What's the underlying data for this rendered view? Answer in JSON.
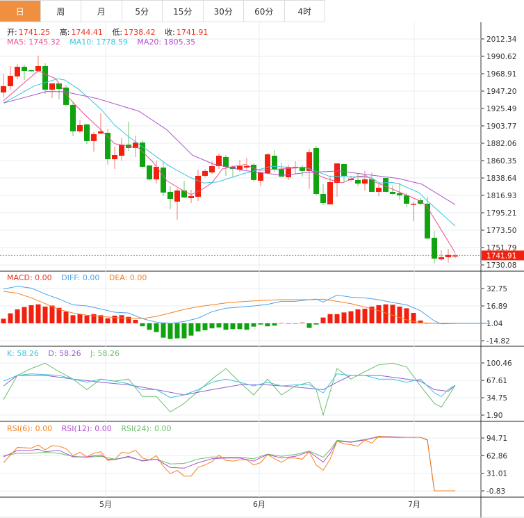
{
  "tabs": [
    {
      "label": "日",
      "active": true
    },
    {
      "label": "周"
    },
    {
      "label": "月"
    },
    {
      "label": "5分"
    },
    {
      "label": "15分"
    },
    {
      "label": "30分"
    },
    {
      "label": "60分"
    },
    {
      "label": "4时"
    }
  ],
  "ohlc": {
    "open_label": "开:",
    "open": "1741.25",
    "high_label": "高:",
    "high": "1744.41",
    "low_label": "低:",
    "low": "1738.42",
    "close_label": "收:",
    "close": "1741.91"
  },
  "ma_legend": {
    "ma5": "MA5: 1745.32",
    "ma10": "MA10: 1778.59",
    "ma20": "MA20: 1805.35"
  },
  "macd_legend": {
    "macd": "MACD: 0.00",
    "diff": "DIFF: 0.00",
    "dea": "DEA: 0.00"
  },
  "kdj_legend": {
    "k": "K: 58.26",
    "d": "D: 58.26",
    "j": "J: 58.26"
  },
  "rsi_legend": {
    "rsi6": "RSI(6): 0.00",
    "rsi12": "RSI(12): 0.00",
    "rsi24": "RSI(24): 0.00"
  },
  "colors": {
    "up": "#f2200e",
    "down": "#10a310",
    "ma5": "#ee4f8f",
    "ma10": "#39c5dd",
    "ma20": "#b04fce",
    "active_tab": "#f18f41",
    "diff": "#4ca3ea",
    "dea": "#f5801e",
    "k": "#39c5dd",
    "d": "#8e5fd0",
    "j": "#6cbe6c",
    "rsi6": "#f5801e",
    "rsi12": "#b04fce",
    "rsi24": "#6cbe6c"
  },
  "chart_data": {
    "type": "candlestick",
    "x_labels": [
      {
        "label": "5月",
        "index": 14.7
      },
      {
        "label": "6月",
        "index": 36.8
      },
      {
        "label": "7月",
        "index": 59.1
      }
    ],
    "current_price": "1741.91",
    "price_ticks": [
      "2012.34",
      "1990.62",
      "1968.91",
      "1947.20",
      "1925.49",
      "1903.77",
      "1882.06",
      "1860.35",
      "1838.64",
      "1816.93",
      "1795.21",
      "1773.50",
      "1751.79",
      "1730.08"
    ],
    "candles_ohlc_note": "[open, close, high, low]",
    "candles": [
      [
        1945.5,
        1953.3,
        1968.9,
        1939.4
      ],
      [
        1953.3,
        1966.3,
        1978.5,
        1949.0
      ],
      [
        1965.5,
        1977.6,
        1981.1,
        1962.0
      ],
      [
        1977.6,
        1972.4,
        1980.2,
        1961.1
      ],
      [
        1973.3,
        1972.4,
        1974.2,
        1971.5
      ],
      [
        1972.4,
        1978.5,
        1991.5,
        1970.7
      ],
      [
        1978.5,
        1949.0,
        1982.0,
        1943.8
      ],
      [
        1949.0,
        1956.8,
        1956.8,
        1938.5
      ],
      [
        1956.8,
        1949.8,
        1956.8,
        1936.8
      ],
      [
        1951.6,
        1929.9,
        1955.0,
        1928.1
      ],
      [
        1929.9,
        1896.9,
        1934.2,
        1890.8
      ],
      [
        1896.9,
        1904.7,
        1910.7,
        1895.1
      ],
      [
        1905.5,
        1884.7,
        1906.4,
        1881.2
      ],
      [
        1884.7,
        1893.4,
        1896.0,
        1871.7
      ],
      [
        1894.2,
        1896.9,
        1919.4,
        1893.4
      ],
      [
        1895.1,
        1862.1,
        1899.5,
        1855.2
      ],
      [
        1862.1,
        1867.3,
        1877.7,
        1849.9
      ],
      [
        1866.5,
        1880.4,
        1889.0,
        1860.4
      ],
      [
        1880.4,
        1876.0,
        1909.0,
        1872.5
      ],
      [
        1876.0,
        1883.0,
        1891.6,
        1864.7
      ],
      [
        1883.0,
        1852.6,
        1885.6,
        1851.7
      ],
      [
        1854.3,
        1836.9,
        1855.2,
        1835.2
      ],
      [
        1836.9,
        1852.6,
        1860.4,
        1831.7
      ],
      [
        1851.7,
        1820.4,
        1858.6,
        1816.1
      ],
      [
        1821.3,
        1812.6,
        1828.2,
        1799.6
      ],
      [
        1809.1,
        1823.0,
        1825.6,
        1786.5
      ],
      [
        1823.0,
        1814.3,
        1835.2,
        1813.5
      ],
      [
        1813.5,
        1816.1,
        1823.9,
        1807.4
      ],
      [
        1815.2,
        1841.3,
        1849.1,
        1810.0
      ],
      [
        1841.3,
        1847.4,
        1849.9,
        1839.5
      ],
      [
        1845.6,
        1853.4,
        1859.5,
        1843.9
      ],
      [
        1853.4,
        1866.5,
        1869.1,
        1849.9
      ],
      [
        1864.7,
        1852.6,
        1867.3,
        1841.3
      ],
      [
        1852.6,
        1849.9,
        1854.3,
        1840.4
      ],
      [
        1849.1,
        1853.4,
        1861.2,
        1846.5
      ],
      [
        1851.7,
        1853.4,
        1863.9,
        1849.1
      ],
      [
        1855.2,
        1836.1,
        1856.9,
        1834.3
      ],
      [
        1835.2,
        1845.6,
        1846.5,
        1828.2
      ],
      [
        1844.7,
        1868.2,
        1869.9,
        1843.9
      ],
      [
        1866.5,
        1849.9,
        1873.4,
        1846.5
      ],
      [
        1849.9,
        1840.4,
        1857.8,
        1840.4
      ],
      [
        1839.5,
        1851.7,
        1855.2,
        1836.1
      ],
      [
        1850.8,
        1852.6,
        1859.5,
        1843.9
      ],
      [
        1852.6,
        1847.4,
        1855.2,
        1840.4
      ],
      [
        1847.4,
        1870.8,
        1875.1,
        1824.8
      ],
      [
        1876.0,
        1818.7,
        1878.6,
        1816.9
      ],
      [
        1818.7,
        1807.4,
        1830.9,
        1804.8
      ],
      [
        1805.7,
        1833.5,
        1841.3,
        1805.7
      ],
      [
        1832.6,
        1856.9,
        1856.9,
        1815.2
      ],
      [
        1856.0,
        1841.3,
        1856.9,
        1834.3
      ],
      [
        1836.1,
        1837.8,
        1841.3,
        1834.3
      ],
      [
        1836.1,
        1831.7,
        1843.9,
        1828.2
      ],
      [
        1831.7,
        1836.9,
        1847.4,
        1823.0
      ],
      [
        1836.9,
        1821.3,
        1845.6,
        1821.3
      ],
      [
        1821.3,
        1826.5,
        1831.7,
        1816.1
      ],
      [
        1838.7,
        1821.3,
        1838.7,
        1820.4
      ],
      [
        1821.3,
        1818.7,
        1829.1,
        1817.8
      ],
      [
        1819.6,
        1816.9,
        1832.6,
        1811.7
      ],
      [
        1816.9,
        1806.5,
        1819.6,
        1802.2
      ],
      [
        1805.7,
        1806.5,
        1809.1,
        1784.8
      ],
      [
        1810.9,
        1806.5,
        1813.5,
        1804.8
      ],
      [
        1806.5,
        1763.1,
        1815.2,
        1763.1
      ],
      [
        1764.0,
        1738.0,
        1772.7,
        1731.8
      ],
      [
        1737.1,
        1739.7,
        1748.3,
        1735.3
      ],
      [
        1739.7,
        1742.5,
        1750.0,
        1733.0
      ],
      [
        1741.25,
        1741.91,
        1744.41,
        1738.42
      ]
    ],
    "ma5": {
      "x": [
        0,
        5,
        6,
        7.5,
        9.5,
        11.5,
        14,
        16,
        19.5,
        21.5,
        23.5,
        26,
        27,
        28.5,
        30,
        31.5,
        32.8,
        34.8,
        36.8,
        39.5,
        43.5,
        45.5,
        46.8,
        48.8,
        50.8,
        52.2,
        53.5,
        56.2,
        59.5,
        60.8,
        65
      ],
      "y": [
        1935.1,
        1972.7,
        1968.4,
        1962.9,
        1937.9,
        1919.4,
        1898.9,
        1881.5,
        1876.0,
        1858.6,
        1835.2,
        1822.2,
        1817.8,
        1823.9,
        1832.6,
        1849.9,
        1852.6,
        1855.4,
        1848.2,
        1849.7,
        1851.9,
        1841.3,
        1836.9,
        1832.6,
        1840.4,
        1841.3,
        1833.5,
        1823.9,
        1811.7,
        1804.8,
        1745.32
      ]
    },
    "ma10": {
      "x": [
        0,
        4.5,
        7.8,
        8.8,
        10.8,
        14,
        16,
        18,
        20.8,
        23.8,
        26.8,
        28.8,
        30.8,
        34.5,
        38.5,
        43.8,
        46.8,
        52.8,
        54.2,
        55.8,
        56.8,
        59.8,
        60.8,
        65
      ],
      "y": [
        1932.2,
        1953.9,
        1962.6,
        1961.1,
        1949.6,
        1924.9,
        1904.7,
        1890.2,
        1872.8,
        1854.0,
        1839.5,
        1832.3,
        1833.7,
        1843.9,
        1853.2,
        1851.1,
        1841.0,
        1839.5,
        1832.3,
        1833.2,
        1831.7,
        1820.2,
        1811.6,
        1778.59
      ]
    },
    "ma20": {
      "x": [
        0,
        6.2,
        8.8,
        13.5,
        19.5,
        23.5,
        27.2,
        30.2,
        34.5,
        40.2,
        43.5,
        48.2,
        52.8,
        56.8,
        60.2,
        65
      ],
      "y": [
        1932.2,
        1946.7,
        1946.3,
        1937.9,
        1922.0,
        1898.9,
        1867.1,
        1856.0,
        1848.2,
        1841.9,
        1845.3,
        1847.4,
        1842.4,
        1838.1,
        1830.9,
        1805.35
      ]
    },
    "macd": {
      "ticks": [
        "32.75",
        "16.89",
        "1.04",
        "-14.82"
      ],
      "histogram": [
        4.2,
        9.1,
        12.7,
        14.8,
        16.5,
        17.3,
        15.2,
        16.2,
        14.1,
        10.6,
        7.4,
        8.4,
        7.0,
        8.4,
        7.4,
        4.6,
        7.0,
        7.4,
        5.9,
        3.2,
        -2.7,
        -5.9,
        -8.0,
        -13.1,
        -14.3,
        -13.7,
        -13.7,
        -11.2,
        -7.4,
        -6.3,
        -4.6,
        -3.8,
        -5.9,
        -5.3,
        -5.3,
        -5.9,
        -3.0,
        -1.1,
        -2.7,
        -2.1,
        0.2,
        0,
        0,
        0.6,
        -4.2,
        -1.1,
        5.3,
        8.4,
        8.4,
        9.9,
        11.0,
        12.7,
        13.3,
        15.2,
        16.5,
        17.3,
        16.9,
        15.2,
        13.7,
        9.5,
        2.5,
        0,
        0,
        0,
        0,
        0
      ],
      "diff": {
        "x": [
          0,
          2,
          4,
          6,
          8,
          10,
          12,
          14,
          16,
          18,
          20,
          22,
          24,
          26,
          28,
          30,
          32,
          34,
          36,
          38,
          40,
          42,
          44,
          45,
          46,
          48,
          50,
          52,
          54,
          56,
          58,
          60,
          62,
          63,
          65,
          70
        ],
        "y": [
          32.3,
          34.8,
          33.1,
          27.8,
          23.2,
          17.9,
          16.9,
          14.1,
          11.2,
          10.5,
          5.3,
          2.1,
          1.0,
          2.7,
          5.7,
          11.6,
          14.8,
          15.8,
          16.9,
          18.3,
          21.1,
          21.1,
          22.6,
          23.2,
          20.4,
          26.8,
          24.9,
          24.2,
          22.6,
          20.0,
          17.9,
          12.6,
          3.2,
          0.6,
          1.0,
          1.0
        ]
      },
      "dea": {
        "x": [
          0,
          2,
          4,
          6,
          8,
          10,
          12,
          14,
          16,
          18,
          20,
          22,
          24,
          26,
          28,
          30,
          32,
          34,
          36,
          38,
          40,
          42,
          44,
          46,
          48,
          50,
          52,
          54,
          56,
          58,
          60,
          62,
          65
        ],
        "y": [
          30.2,
          28.5,
          24.3,
          19.0,
          13.7,
          10.5,
          8.4,
          7.4,
          6.3,
          5.7,
          5.3,
          7.4,
          10.5,
          13.7,
          16.2,
          17.9,
          19.6,
          20.7,
          21.5,
          22.1,
          22.6,
          22.6,
          22.6,
          23.0,
          21.1,
          19.0,
          15.8,
          12.6,
          8.4,
          4.2,
          1.5,
          1.0,
          1.0
        ]
      }
    },
    "kdj": {
      "ticks": [
        "100.46",
        "67.61",
        "34.75",
        "1.90"
      ],
      "k": {
        "x": [
          0,
          2,
          4,
          8,
          10,
          12,
          14,
          16,
          18,
          20,
          22,
          24,
          26,
          28,
          30,
          32,
          34,
          36,
          38,
          40,
          42,
          44,
          46,
          48,
          50,
          52,
          54,
          56,
          58,
          60,
          62,
          63,
          64,
          65
        ],
        "y": [
          66,
          77,
          80,
          77,
          70,
          64,
          70,
          66,
          61,
          50,
          50,
          35,
          40,
          50,
          64,
          70,
          64,
          57,
          64,
          57,
          59,
          59,
          44,
          80,
          77,
          77,
          70,
          70,
          64,
          70,
          44,
          37,
          50,
          58.26
        ]
      },
      "d": {
        "x": [
          0,
          2,
          6,
          10,
          14,
          18,
          22,
          26,
          30,
          34,
          38,
          42,
          46,
          48,
          50,
          54,
          58,
          60,
          62,
          64,
          65
        ],
        "y": [
          57,
          77,
          77,
          70,
          64,
          59,
          50,
          40,
          50,
          59,
          59,
          55,
          50,
          64,
          77,
          77,
          70,
          66,
          50,
          47,
          58.26
        ]
      },
      "j": {
        "x": [
          0,
          2,
          4,
          6,
          8,
          10,
          12,
          14,
          16,
          18,
          20,
          22,
          24,
          26,
          28,
          30,
          32,
          34,
          36,
          38,
          40,
          42,
          44,
          45,
          46,
          48,
          50,
          52,
          54,
          56,
          58,
          60,
          62,
          63,
          64,
          65
        ],
        "y": [
          31,
          77,
          90,
          100,
          84,
          70,
          50,
          70,
          66,
          70,
          37,
          37,
          8,
          24,
          47,
          70,
          90,
          64,
          40,
          70,
          40,
          57,
          64,
          50,
          2,
          90,
          70,
          84,
          97,
          100,
          93,
          57,
          24,
          17,
          37,
          58.26
        ]
      }
    },
    "rsi": {
      "ticks": [
        "94.71",
        "62.86",
        "31.01",
        "-0.83"
      ],
      "rsi6": {
        "x": [
          0,
          2,
          4,
          5,
          6,
          7,
          8,
          9,
          10,
          11,
          12,
          13,
          14,
          15,
          16,
          17,
          18,
          19,
          20,
          21,
          22,
          23,
          24,
          25,
          26,
          27,
          28,
          29,
          30,
          31,
          32,
          33,
          34,
          35,
          36,
          37,
          38,
          39,
          40,
          41,
          42,
          43,
          44,
          45,
          46,
          47,
          48,
          49,
          50,
          51,
          52,
          53,
          54,
          55,
          56,
          57,
          58,
          59,
          60,
          61,
          62,
          65
        ],
        "y": [
          50.1,
          77.7,
          76.5,
          82,
          73.5,
          81,
          79.9,
          75.6,
          62.9,
          69,
          60.7,
          67,
          70,
          54.4,
          55.6,
          69,
          67,
          72.6,
          58.6,
          55,
          62.9,
          43.7,
          30.2,
          36.1,
          25.9,
          25.9,
          41.6,
          45.9,
          52.2,
          63.7,
          54.4,
          53.1,
          55.2,
          55.2,
          45.9,
          50.1,
          65,
          57.3,
          51,
          58.6,
          58.6,
          56.5,
          70,
          45.9,
          36.5,
          56.5,
          89.2,
          84.1,
          82.8,
          79.9,
          91.3,
          85.4,
          98.1,
          96.8,
          96,
          95.6,
          96,
          95.6,
          96.4,
          90.5,
          -0.8,
          -0.8
        ]
      },
      "rsi12": {
        "x": [
          0,
          2,
          4,
          5,
          6,
          8,
          10,
          12,
          14,
          15,
          16,
          18,
          20,
          22,
          24,
          26,
          28,
          30,
          32,
          34,
          36,
          38,
          40,
          42,
          44,
          45,
          46,
          47,
          48,
          50,
          52,
          54,
          56,
          58,
          60,
          61,
          62,
          65
        ],
        "y": [
          60.7,
          72.2,
          72.6,
          74.3,
          70,
          72.6,
          60.7,
          60.7,
          64.1,
          56.5,
          55.6,
          61.6,
          53.1,
          56.5,
          41.6,
          40.3,
          50.1,
          57.3,
          58.6,
          58.6,
          53.1,
          65,
          58.6,
          61.6,
          70,
          60.7,
          51.4,
          67,
          89.2,
          87.1,
          91.3,
          97.7,
          96.8,
          96,
          96,
          91.3,
          -0.8,
          -0.8
        ]
      },
      "rsi24": {
        "x": [
          0,
          2,
          4,
          6,
          8,
          10,
          12,
          14,
          16,
          18,
          20,
          22,
          24,
          26,
          28,
          30,
          32,
          34,
          36,
          38,
          40,
          42,
          44,
          45,
          46,
          47,
          48,
          50,
          52,
          54,
          56,
          60,
          61,
          62,
          65
        ],
        "y": [
          62.9,
          67,
          67,
          69,
          67,
          61.6,
          59.9,
          61.6,
          56.5,
          59.9,
          54.4,
          56.5,
          48,
          48.8,
          56.5,
          60.7,
          59.9,
          59.9,
          57.3,
          65.8,
          61.6,
          65,
          71.3,
          65.8,
          59.9,
          73.5,
          90.5,
          87.9,
          92.2,
          96.4,
          96,
          96,
          91.7,
          -0.8,
          -0.8
        ]
      }
    }
  }
}
